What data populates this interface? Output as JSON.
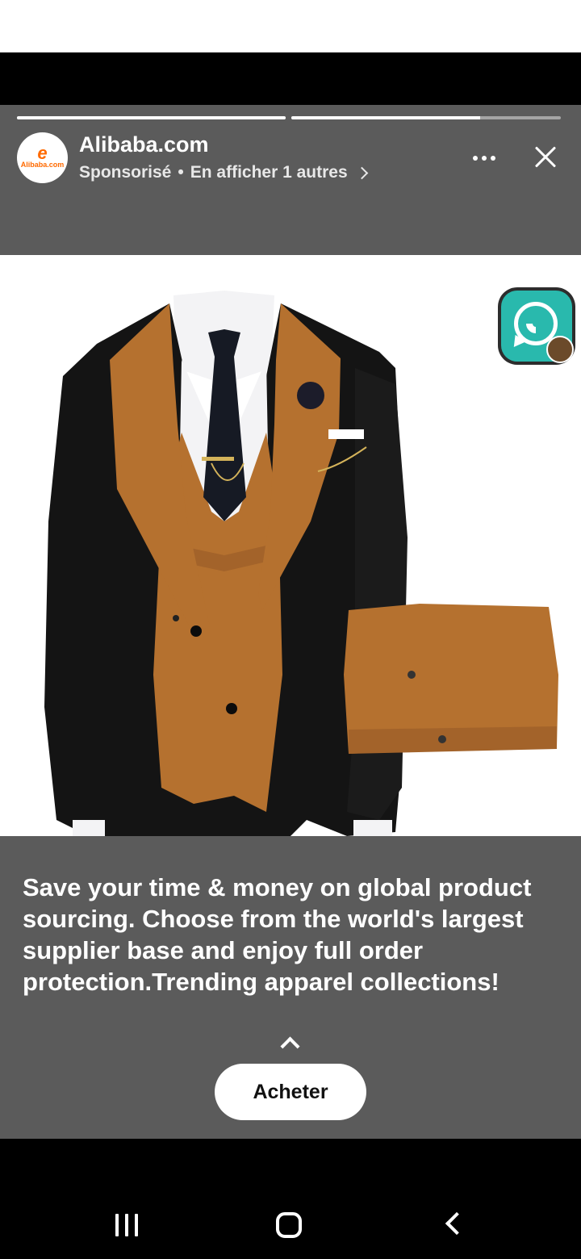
{
  "story": {
    "progress": [
      1.0,
      0.7
    ],
    "advertiser": {
      "name": "Alibaba.com",
      "avatar_mark": "e",
      "avatar_brand": "Alibaba.com",
      "sponsored": "Sponsorisé",
      "separator": "•",
      "more_link": "En afficher 1 autres"
    },
    "icons": {
      "more": "more-horizontal-icon",
      "close": "close-icon",
      "expand": "chevron-up-icon",
      "chevron": "chevron-right-icon"
    },
    "caption": "Save your time & money on global product sourcing. Choose from the world's largest supplier base and enjoy full order protection.Trending apparel collections!",
    "cta_label": "Acheter",
    "floating_app": "whatsapp-icon"
  },
  "colors": {
    "story_bg": "#5b5b5b",
    "brand": "#ff6a00",
    "whatsapp": "#29b9ad",
    "lapel_brown": "#b5712f",
    "jacket_black": "#141414"
  },
  "navbar": {
    "recent": "recent-apps-icon",
    "home": "home-icon",
    "back": "back-icon"
  }
}
